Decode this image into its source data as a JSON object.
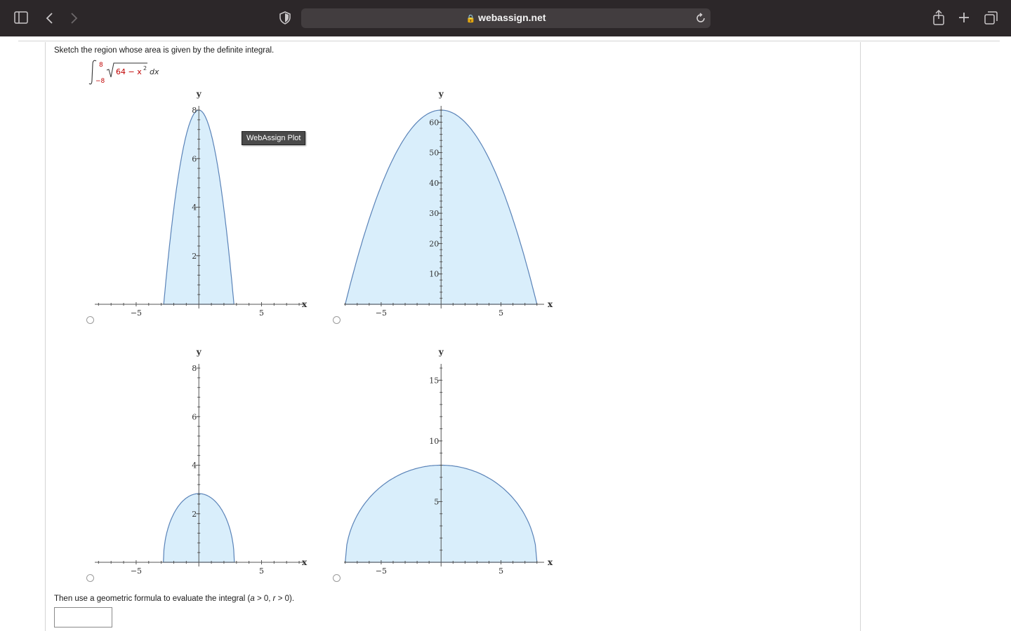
{
  "browser": {
    "url": "webassign.net"
  },
  "question": {
    "prompt": "Sketch the region whose area is given by the definite integral.",
    "integral": {
      "upper": "8",
      "lower": "−8",
      "radicand": "64 − x",
      "exponent": "2",
      "differential": "dx"
    },
    "tooltip": "WebAssign Plot",
    "followup_prefix": "Then use a geometric formula to evaluate the integral (",
    "followup_a": "a",
    "followup_mid": " > 0,  ",
    "followup_r": "r",
    "followup_suffix": " > 0).",
    "answer_value": ""
  },
  "chart_data": [
    {
      "type": "area",
      "function": "narrow parabola",
      "x": [
        -2.8,
        -2.0,
        -1.0,
        0.0,
        1.0,
        2.0,
        2.8
      ],
      "y": [
        0,
        4.0,
        7.0,
        8.0,
        7.0,
        4.0,
        0
      ],
      "xlabel": "x",
      "ylabel": "y",
      "xticks": [
        "−5",
        "5"
      ],
      "yticks": [
        "2",
        "4",
        "6",
        "8"
      ],
      "xlim": [
        -8.3,
        8.5
      ],
      "ylim": [
        0,
        8.0
      ]
    },
    {
      "type": "area",
      "function": "wide parabola",
      "x": [
        -8,
        -6,
        -4,
        -2,
        0,
        2,
        4,
        6,
        8
      ],
      "y": [
        0,
        28,
        48,
        60,
        64,
        60,
        48,
        28,
        0
      ],
      "xlabel": "x",
      "ylabel": "y",
      "xticks": [
        "−5",
        "5"
      ],
      "yticks": [
        "10",
        "20",
        "30",
        "40",
        "50",
        "60"
      ],
      "xlim": [
        -8.1,
        8.6
      ],
      "ylim": [
        0,
        64
      ]
    },
    {
      "type": "area",
      "function": "small semicircle",
      "x": [
        -2.83,
        -2,
        -1,
        0,
        1,
        2,
        2.83
      ],
      "y": [
        0,
        2.0,
        2.65,
        2.83,
        2.65,
        2.0,
        0
      ],
      "xlabel": "x",
      "ylabel": "y",
      "xticks": [
        "−5",
        "5"
      ],
      "yticks": [
        "2",
        "4",
        "6",
        "8"
      ],
      "xlim": [
        -8.3,
        8.5
      ],
      "ylim": [
        0,
        8.0
      ]
    },
    {
      "type": "area",
      "function": "semicircle radius 8",
      "x": [
        -8,
        -6,
        -4,
        -2,
        0,
        2,
        4,
        6,
        8
      ],
      "y": [
        0,
        5.29,
        6.93,
        7.75,
        8,
        7.75,
        6.93,
        5.29,
        0
      ],
      "xlabel": "x",
      "ylabel": "y",
      "xticks": [
        "−5",
        "5"
      ],
      "yticks": [
        "5",
        "10",
        "15"
      ],
      "xlim": [
        -8.1,
        8.6
      ],
      "ylim": [
        0,
        16
      ]
    }
  ]
}
